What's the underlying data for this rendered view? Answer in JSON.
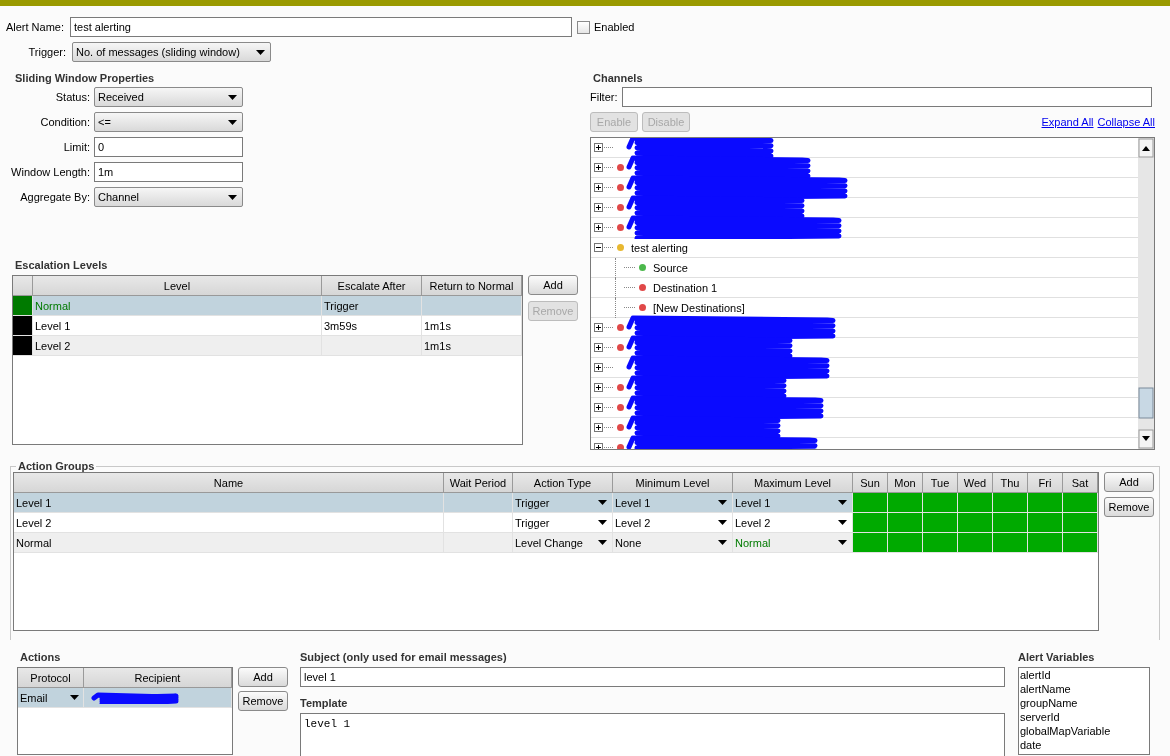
{
  "header": {
    "alert_name_label": "Alert Name:",
    "alert_name": "test alerting",
    "enabled": {
      "label": "Enabled",
      "checked": false
    },
    "trigger_label": "Trigger:",
    "trigger": "No. of messages (sliding window)"
  },
  "sliding_window": {
    "title": "Sliding Window Properties",
    "fields": [
      {
        "label": "Status:",
        "value": "Received",
        "kind": "dropdown"
      },
      {
        "label": "Condition:",
        "value": "<=",
        "kind": "dropdown"
      },
      {
        "label": "Limit:",
        "value": "0",
        "kind": "text"
      },
      {
        "label": "Window Length:",
        "value": "1m",
        "kind": "text"
      },
      {
        "label": "Aggregate By:",
        "value": "Channel",
        "kind": "dropdown"
      }
    ]
  },
  "escalation": {
    "title": "Escalation Levels",
    "columns": [
      "Level",
      "Escalate After",
      "Return to Normal"
    ],
    "rows": [
      {
        "color": "#007a00",
        "level": "Normal",
        "escalate_after": "Trigger",
        "selected": true
      },
      {
        "color": "#000000",
        "level": "Level 1",
        "escalate_after": "3m59s",
        "return_to_normal": "1m1s",
        "selected": false
      },
      {
        "color": "#000000",
        "level": "Level 2",
        "return_to_normal": "1m1s",
        "selected": false
      }
    ],
    "buttons": [
      {
        "label": "Add",
        "disabled": false
      },
      {
        "label": "Remove",
        "disabled": true
      }
    ]
  },
  "channels": {
    "title": "Channels",
    "filter_label": "Filter:",
    "buttons": [
      {
        "label": "Enable",
        "disabled": true
      },
      {
        "label": "Disable",
        "disabled": true
      }
    ],
    "links": [
      "Expand All",
      "Collapse All"
    ],
    "tree": [
      {
        "redacted": true,
        "expanded": false
      },
      {
        "redacted": true,
        "expanded": false,
        "color": "#e04848"
      },
      {
        "redacted": true,
        "expanded": false,
        "color": "#e04848"
      },
      {
        "redacted": true,
        "expanded": false,
        "color": "#e04848"
      },
      {
        "redacted": true,
        "expanded": false,
        "color": "#e04848"
      },
      {
        "label": "test alerting",
        "expanded": true,
        "color": "#e8b830",
        "children": [
          {
            "label": "Source",
            "color": "#4cb84c"
          },
          {
            "label": "Destination 1",
            "color": "#e04848"
          },
          {
            "label": "[New Destinations]",
            "color": "#e04848"
          }
        ]
      },
      {
        "redacted": true,
        "expanded": false,
        "color": "#e04848"
      },
      {
        "redacted": true,
        "expanded": false,
        "color": "#e04848"
      },
      {
        "redacted": true,
        "expanded": false
      },
      {
        "redacted": true,
        "expanded": false,
        "color": "#e04848"
      },
      {
        "redacted": true,
        "expanded": false,
        "color": "#e04848"
      },
      {
        "redacted": true,
        "expanded": false,
        "color": "#e04848"
      },
      {
        "redacted": true,
        "expanded": false,
        "color": "#e04848"
      }
    ]
  },
  "action_groups": {
    "title": "Action Groups",
    "columns": [
      "Name",
      "Wait Period",
      "Action Type",
      "Minimum Level",
      "Maximum Level",
      "Sun",
      "Mon",
      "Tue",
      "Wed",
      "Thu",
      "Fri",
      "Sat"
    ],
    "rows": [
      {
        "name": "Level 1",
        "action_type": "Trigger",
        "min_level": "Level 1",
        "max_level": "Level 1",
        "days": [
          true,
          true,
          true,
          true,
          true,
          true,
          true
        ],
        "selected": true
      },
      {
        "name": "Level 2",
        "action_type": "Trigger",
        "min_level": "Level 2",
        "max_level": "Level 2",
        "days": [
          true,
          true,
          true,
          true,
          true,
          true,
          true
        ],
        "selected": false
      },
      {
        "name": "Normal",
        "action_type": "Level Change",
        "min_level": "None",
        "max_level": "Normal",
        "color": "#007a00",
        "days": [
          true,
          true,
          true,
          true,
          true,
          true,
          true
        ],
        "selected": false
      }
    ],
    "buttons": [
      {
        "label": "Add",
        "disabled": false
      },
      {
        "label": "Remove",
        "disabled": false
      }
    ]
  },
  "actions": {
    "title": "Actions",
    "columns": [
      "Protocol",
      "Recipient"
    ],
    "rows": [
      {
        "protocol": "Email",
        "recipient_redacted": true,
        "selected": true
      }
    ],
    "buttons": [
      {
        "label": "Add",
        "disabled": false
      },
      {
        "label": "Remove",
        "disabled": false
      }
    ]
  },
  "subject": {
    "title": "Subject (only used for email messages)",
    "value": "level 1"
  },
  "template": {
    "title": "Template",
    "value": "level 1"
  },
  "alert_variables": {
    "title": "Alert Variables",
    "items": [
      "alertId",
      "alertName",
      "groupName",
      "serverId",
      "globalMapVariable",
      "date"
    ]
  }
}
